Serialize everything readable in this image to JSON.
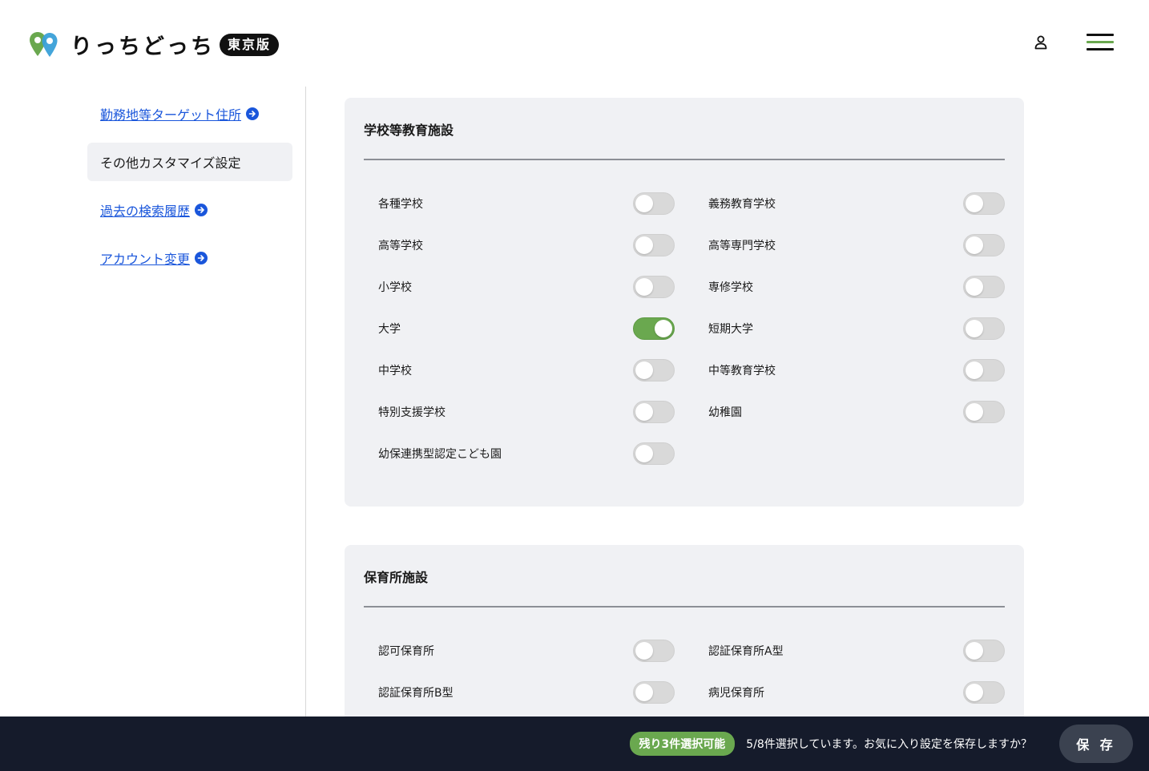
{
  "header": {
    "logo_text": "りっちどっち",
    "logo_badge": "東京版",
    "colors": {
      "pin_green": "#6aa84f",
      "pin_blue": "#3aa0d8"
    }
  },
  "sidebar": {
    "items": [
      {
        "label": "勤務地等ターゲット住所",
        "active": false
      },
      {
        "label": "その他カスタマイズ設定",
        "active": true
      },
      {
        "label": "過去の検索履歴",
        "active": false
      },
      {
        "label": "アカウント変更",
        "active": false
      }
    ]
  },
  "sections": [
    {
      "title": "学校等教育施設",
      "left": [
        {
          "label": "各種学校",
          "on": false
        },
        {
          "label": "高等学校",
          "on": false
        },
        {
          "label": "小学校",
          "on": false
        },
        {
          "label": "大学",
          "on": true
        },
        {
          "label": "中学校",
          "on": false
        },
        {
          "label": "特別支援学校",
          "on": false
        },
        {
          "label": "幼保連携型認定こども園",
          "on": false
        }
      ],
      "right": [
        {
          "label": "義務教育学校",
          "on": false
        },
        {
          "label": "高等専門学校",
          "on": false
        },
        {
          "label": "専修学校",
          "on": false
        },
        {
          "label": "短期大学",
          "on": false
        },
        {
          "label": "中等教育学校",
          "on": false
        },
        {
          "label": "幼稚園",
          "on": false
        }
      ]
    },
    {
      "title": "保育所施設",
      "left": [
        {
          "label": "認可保育所",
          "on": false
        },
        {
          "label": "認証保育所B型",
          "on": false
        }
      ],
      "right": [
        {
          "label": "認証保育所A型",
          "on": false
        },
        {
          "label": "病児保育所",
          "on": false
        }
      ]
    }
  ],
  "bottom_bar": {
    "remaining_badge": "残り3件選択可能",
    "message": "5/8件選択しています。お気に入り設定を保存しますか？",
    "save_label": "保 存"
  }
}
